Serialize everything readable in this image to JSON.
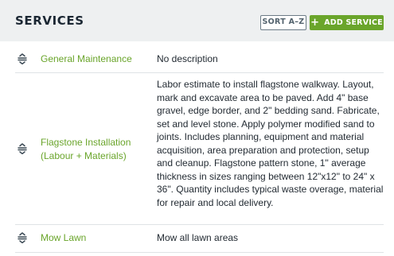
{
  "header": {
    "title": "SERVICES",
    "sort_label": "SORT A–Z",
    "add_label": "ADD SERVICE",
    "add_icon": "plus-icon"
  },
  "colors": {
    "accent_green": "#6aa52b",
    "header_bg": "#eef0f1",
    "text_dark": "#232b33",
    "border": "#dfe3e6"
  },
  "services": [
    {
      "name": "General Maintenance",
      "description": "No description",
      "handle_icon": "drag-handle-icon"
    },
    {
      "name": "Flagstone Installation (Labour + Materials)",
      "description": "Labor estimate to install flagstone walkway. Layout, mark and excavate area to be paved. Add 4\" base gravel, edge border, and 2\" bedding sand. Fabricate, set and level stone. Apply polymer modified sand to joints. Includes planning, equipment and material acquisition, area preparation and protection, setup and cleanup. Flagstone pattern stone, 1\" average thickness in sizes ranging between 12\"x12\" to 24\" x 36\". Quantity includes typical waste overage, material for repair and local delivery.",
      "handle_icon": "drag-handle-icon"
    },
    {
      "name": "Mow Lawn",
      "description": "Mow all lawn areas",
      "handle_icon": "drag-handle-icon"
    }
  ]
}
